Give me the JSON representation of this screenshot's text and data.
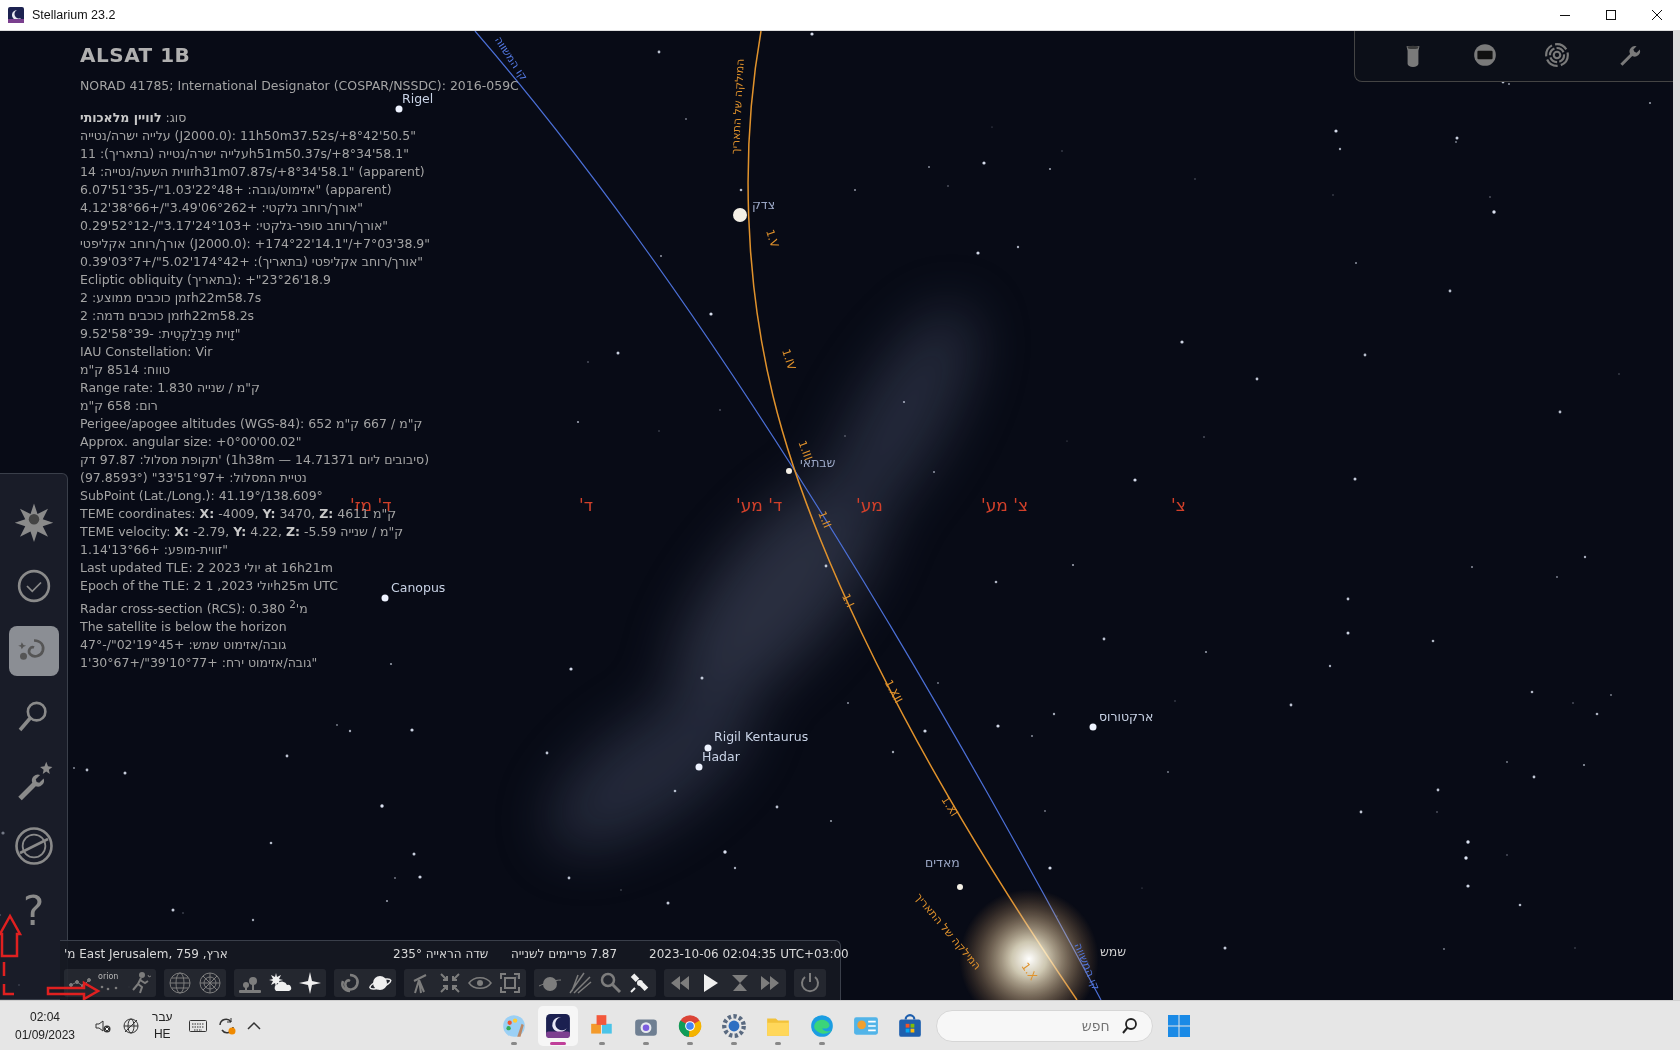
{
  "window": {
    "title": "Stellarium 23.2"
  },
  "info": {
    "title": "ALSAT 1B",
    "designation": "NORAD 41785; International Designator (COSPAR/NSSDC): 2016-059C",
    "lines": [
      "סוג: **לוויין מלאכותי**",
      "עלייה ישרה/נטייה (J2000.0): 11h50m37.52s/+8°42'50.5\"",
      "עלייה ישרה/נטייה (בתאריך): 11h51m50.37s/+8°34'58.1\"",
      "זווית השעה/נטייה: 14h31m07.87s/+8°34'58.1\" (apparent)",
      "אזימוט/גובה: +22°48'1.03\"/-51°35'6.07\" (apparent)",
      "אורך/רוחב גלקטי: +06°262'3.49\"/+38°66'4.12\"",
      "אורך/רוחב סופר-גלקטי: +24°103'3.17\"/-52°12'0.29\"",
      "אורך/רוחב אקליפטי (J2000.0): +174°22'14.1\"/+7°03'38.9\"",
      "אורך/רוחב אקליפטי (בתאריך): +174°42'5.02\"/+03°7'0.39\"",
      "Ecliptic obliquity (בתאריך): +\"18.9'23°26",
      "זמן כוכבים ממוצע: 2h22m58.7s",
      "זמן כוכבים נדמה: 2h22m58.2s",
      "זָוית פָּרַלַקְטִית: -58°39'9.52\"",
      "IAU Constellation: Vir",
      "טווח: 8514 ק\"מ",
      "Range rate: 1.830 ק\"מ / שנייה",
      "רום: 658 ק\"מ",
      "Perigee/apogee altitudes (WGS-84): 652 ק\"מ / 667 ק\"מ",
      "Approx. angular size: +0°00'00.02\"",
      "תקופת מסלול: 97.87 דק' (1h38m — 14.71371 סיבובים ליום)",
      "נטיית המסלול: +51°97'33\" (97.8593°)",
      "SubPoint (Lat./Long.): 41.19°/138.609°",
      "TEME coordinates: **X:** -4009, **Y:** 3470, **Z:** 4611 ק\"מ",
      "TEME velocity: **X:** -2.79, **Y:** 4.22, **Z:** -5.59 ק\"מ / שנייה",
      "זווית-מופע: +13°66'1.14\"",
      "Last updated TLE: 2 יולי 2023 at 16h21m",
      "Epoch of the TLE: 2 יולי 2023, 1h25m UTC",
      "Radar cross-section (RCS): 0.380 מ'$^{2}$",
      "The satellite is below the horizon",
      "גובה/אזימוט שמש: +19°45'02\"/-47°",
      "גובה/אזימוט ירח: +10°77'39\"/+30°67'1\""
    ]
  },
  "sky": {
    "objects": [
      {
        "kind": "star",
        "label": "Rigel"
      },
      {
        "kind": "star",
        "label": "Canopus"
      },
      {
        "kind": "planet",
        "label": "צדק"
      },
      {
        "kind": "planet",
        "label": "שבתאי"
      },
      {
        "kind": "star",
        "label": "Rigil Kentaurus"
      },
      {
        "kind": "star",
        "label": "Hadar"
      },
      {
        "kind": "star",
        "label": "ארקטורוס"
      },
      {
        "kind": "planet",
        "label": "מאדים"
      },
      {
        "kind": "sun",
        "label": "שמש"
      }
    ],
    "cardinals": [
      "צ'",
      "צ' מע'",
      "מע'",
      "ד' מע'",
      "ד'",
      "ד' מז'"
    ],
    "equator": {
      "labels": [
        "קו המשווה",
        "קו המשווה"
      ]
    },
    "ecliptic": {
      "labels": [
        "המילקה של התאריך",
        "המילקה של התאריך"
      ],
      "marks": [
        "1.V",
        "1.IV",
        "1.III",
        "1.II",
        "1.I",
        "1.XII",
        "1.XI",
        "1.X"
      ]
    }
  },
  "sidebar": {
    "items": [
      {
        "kind": "location",
        "selected": false
      },
      {
        "kind": "time",
        "selected": false
      },
      {
        "kind": "sky",
        "selected": true
      },
      {
        "kind": "search",
        "selected": false
      },
      {
        "kind": "settings",
        "selected": false
      },
      {
        "kind": "calculator",
        "selected": false
      },
      {
        "kind": "help",
        "selected": false,
        "glyph": "?"
      }
    ]
  },
  "bottom_bar": {
    "location": "ארץ, East Jerusalem, 759 מ'",
    "fov": "שדה הראייה 235°",
    "fps": "7.87 פריימים לשנייה",
    "datetime": "2023-10-06 02:04:35 UTC+03:00",
    "groups": [
      [
        {
          "kind": "lines",
          "on": false
        },
        {
          "kind": "labels",
          "on": false,
          "text": "orion"
        },
        {
          "kind": "art",
          "on": false
        }
      ],
      [
        {
          "kind": "azgrid",
          "on": false
        },
        {
          "kind": "eqgrid",
          "on": false
        }
      ],
      [
        {
          "kind": "ground",
          "on": false
        },
        {
          "kind": "atmosphere",
          "on": true
        },
        {
          "kind": "stars",
          "on": true
        }
      ],
      [
        {
          "kind": "nebulae",
          "on": false
        },
        {
          "kind": "planets",
          "on": true
        }
      ],
      [
        {
          "kind": "mount",
          "on": false
        },
        {
          "kind": "center",
          "on": false
        },
        {
          "kind": "eye",
          "on": false
        },
        {
          "kind": "fullscreen",
          "on": false
        }
      ],
      [
        {
          "kind": "exoplanet",
          "on": false
        },
        {
          "kind": "meteor",
          "on": false
        },
        {
          "kind": "search",
          "on": false
        },
        {
          "kind": "satellite",
          "on": true
        }
      ],
      [
        {
          "kind": "rewind",
          "on": false
        },
        {
          "kind": "play",
          "on": true
        },
        {
          "kind": "now",
          "on": false
        },
        {
          "kind": "forward",
          "on": false
        }
      ],
      [
        {
          "kind": "quit",
          "on": false
        }
      ]
    ]
  },
  "taskbar": {
    "time": "02:04",
    "date": "01/09/2023",
    "lang_top": "עבר",
    "lang_bottom": "HE",
    "apps": [
      {
        "kind": "paint",
        "running": true,
        "active": false
      },
      {
        "kind": "stellarium",
        "running": true,
        "active": true
      },
      {
        "kind": "boxes",
        "running": true,
        "active": false
      },
      {
        "kind": "camera",
        "running": true,
        "active": false
      },
      {
        "kind": "chrome",
        "running": true,
        "active": false
      },
      {
        "kind": "settings",
        "running": true,
        "active": false
      },
      {
        "kind": "folder",
        "running": true,
        "active": false
      },
      {
        "kind": "edge",
        "running": true,
        "active": false
      },
      {
        "kind": "controlpanel",
        "running": false,
        "active": false
      },
      {
        "kind": "store",
        "running": false,
        "active": false
      }
    ],
    "search": {
      "placeholder": "חפש"
    }
  }
}
